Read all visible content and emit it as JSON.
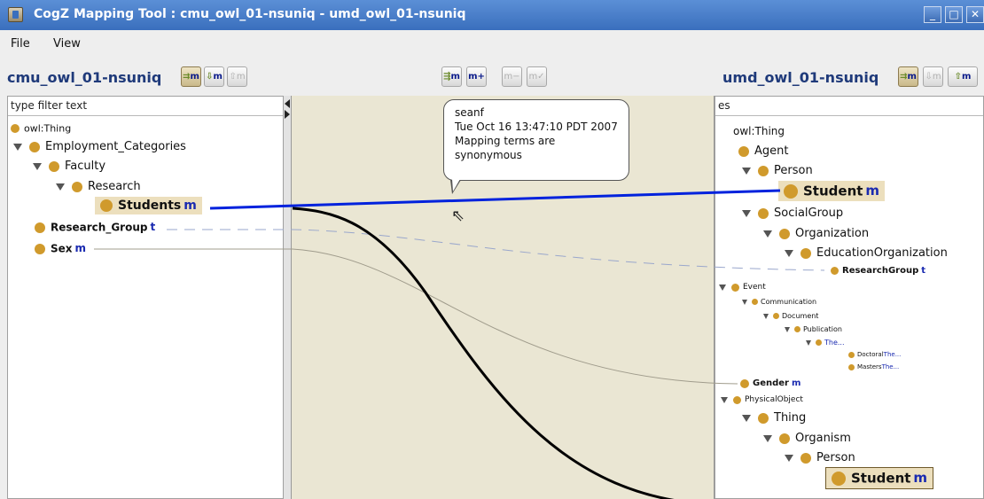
{
  "window": {
    "title": "CogZ Mapping Tool : cmu_owl_01-nsuniq - umd_owl_01-nsuniq"
  },
  "menu": {
    "file": "File",
    "view": "View"
  },
  "source": {
    "name": "cmu_owl_01-nsuniq",
    "filter_placeholder": "type filter text",
    "nodes": {
      "owl_thing": "owl:Thing",
      "employment_categories": "Employment_Categories",
      "faculty": "Faculty",
      "research": "Research",
      "students": "Students",
      "research_group": "Research_Group",
      "sex": "Sex"
    }
  },
  "target": {
    "name": "umd_owl_01-nsuniq",
    "filter_value": "es",
    "nodes": {
      "owl_thing": "owl:Thing",
      "agent": "Agent",
      "person": "Person",
      "student": "Student",
      "social_group": "SocialGroup",
      "organization": "Organization",
      "education_organization": "EducationOrganization",
      "research_group": "ResearchGroup",
      "event": "Event",
      "communication": "Communication",
      "document": "Document",
      "publication": "Publication",
      "the": "The...",
      "doctoral_the_prefix": "Doctoral",
      "doctoral_the_suffix": "The...",
      "masters_the_prefix": "Masters",
      "masters_the_suffix": "The...",
      "gender": "Gender",
      "physical_object": "PhysicalObject",
      "thing": "Thing",
      "organism": "Organism",
      "person2": "Person",
      "student2": "Student"
    }
  },
  "badges": {
    "mapped": "m",
    "temporary": "t"
  },
  "tooltip": {
    "user": "seanf",
    "date": "Tue Oct 16 13:47:10 PDT 2007",
    "comment": "Mapping terms are synonymous"
  },
  "toolbar": {
    "m_plus": "m+",
    "m_minus": "m−",
    "m_check": "m✓"
  },
  "colors": {
    "accent": "#1f3a7a",
    "mapping_line": "#0022dd",
    "highlight": "#ecdfbd",
    "node_dot": "#d09a2c"
  }
}
